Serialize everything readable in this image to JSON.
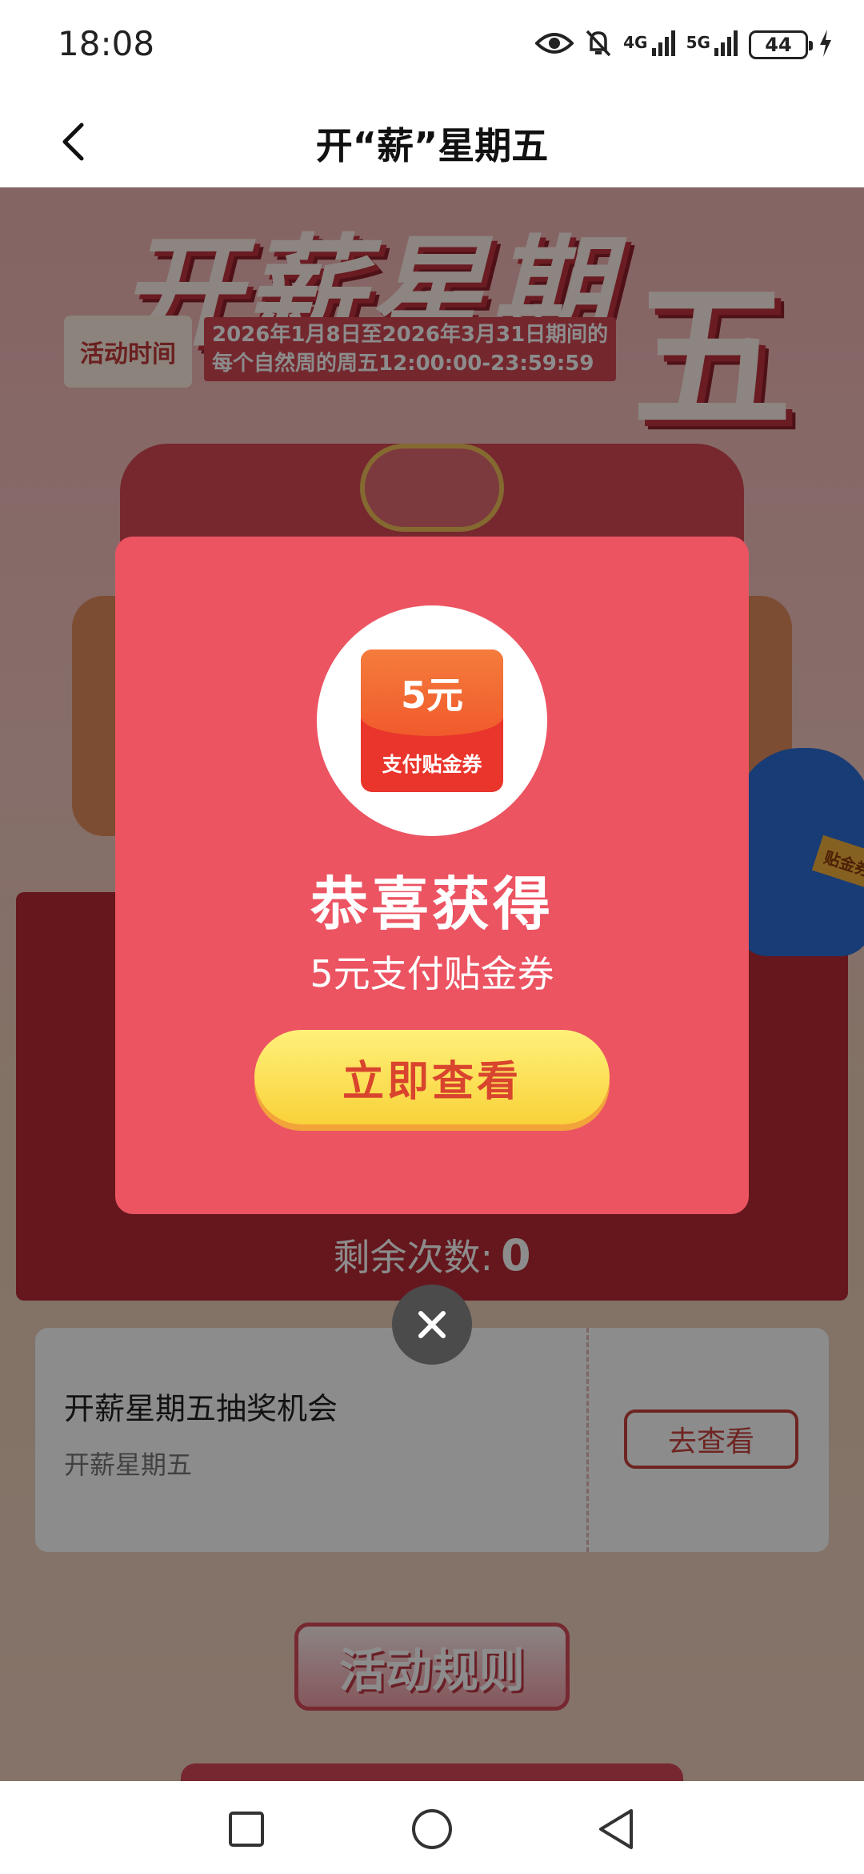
{
  "status_bar": {
    "time": "18:08",
    "network_1": "4G",
    "network_2": "5G",
    "battery": "44",
    "icons": [
      "eye-icon",
      "bell-off-icon",
      "signal-icon",
      "signal-icon",
      "battery-icon",
      "charging-icon"
    ]
  },
  "nav": {
    "title": "开“薪”星期五",
    "back_icon": "chevron-left-icon"
  },
  "activity": {
    "hero_title": "开薪星期",
    "hero_big": "五",
    "time_chip": "活动时间",
    "time_line1": "2026年1月8日至2026年3月31日期间的",
    "time_line2": "每个自然周的周五12:00:00-23:59:59",
    "mascot_tag": "贴金券",
    "remaining_label": "剩余次数:",
    "remaining_count": "0",
    "chance_title": "开薪星期五抽奖机会",
    "chance_subtitle": "开薪星期五",
    "chance_button": "去查看",
    "rules_button": "活动规则"
  },
  "modal": {
    "coupon_amount": "5元",
    "coupon_label": "支付贴金券",
    "congrats": "恭喜获得",
    "prize_name": "5元支付贴金券",
    "view_now_button": "立即查看",
    "close_icon": "close-icon"
  },
  "system_nav": {
    "icons": [
      "recents-square-icon",
      "home-circle-icon",
      "back-triangle-icon"
    ]
  },
  "colors": {
    "modal_bg": "#ec5462",
    "button_yellow": "#f9d23a",
    "button_text": "#d9442e",
    "overlay": "rgba(0,0,0,0.45)"
  }
}
